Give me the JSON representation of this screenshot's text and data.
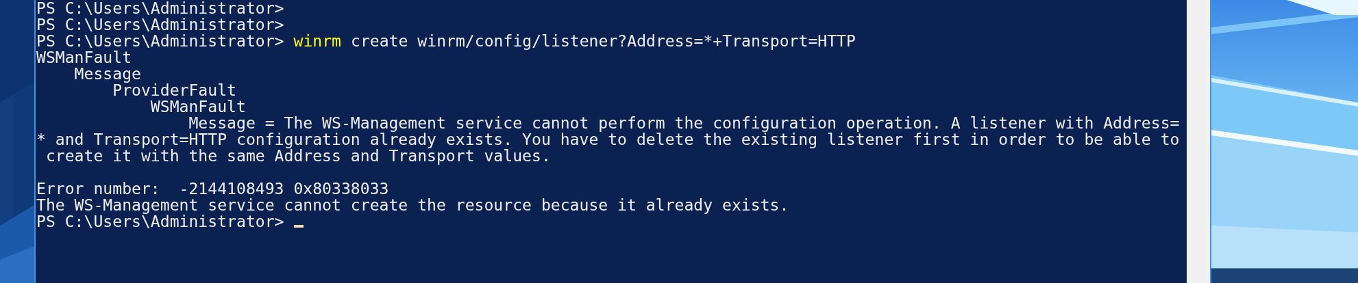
{
  "console": {
    "lines": [
      {
        "kind": "prompt",
        "prompt": "PS C:\\Users\\Administrator>"
      },
      {
        "kind": "prompt",
        "prompt": "PS C:\\Users\\Administrator>"
      },
      {
        "kind": "command",
        "prompt": "PS C:\\Users\\Administrator>",
        "command": "winrm",
        "arguments": "create winrm/config/listener?Address=*+Transport=HTTP"
      },
      {
        "kind": "output",
        "text": "WSManFault"
      },
      {
        "kind": "output",
        "text": "    Message"
      },
      {
        "kind": "output",
        "text": "        ProviderFault"
      },
      {
        "kind": "output",
        "text": "            WSManFault"
      },
      {
        "kind": "output",
        "text": "                Message = The WS-Management service cannot perform the configuration operation. A listener with Address="
      },
      {
        "kind": "output",
        "text": "* and Transport=HTTP configuration already exists. You have to delete the existing listener first in order to be able to"
      },
      {
        "kind": "output",
        "text": " create it with the same Address and Transport values."
      },
      {
        "kind": "blank"
      },
      {
        "kind": "output",
        "text": "Error number:  -2144108493 0x80338033"
      },
      {
        "kind": "output",
        "text": "The WS-Management service cannot create the resource because it already exists."
      },
      {
        "kind": "prompt",
        "prompt": "PS C:\\Users\\Administrator>",
        "cursor": true
      }
    ]
  }
}
